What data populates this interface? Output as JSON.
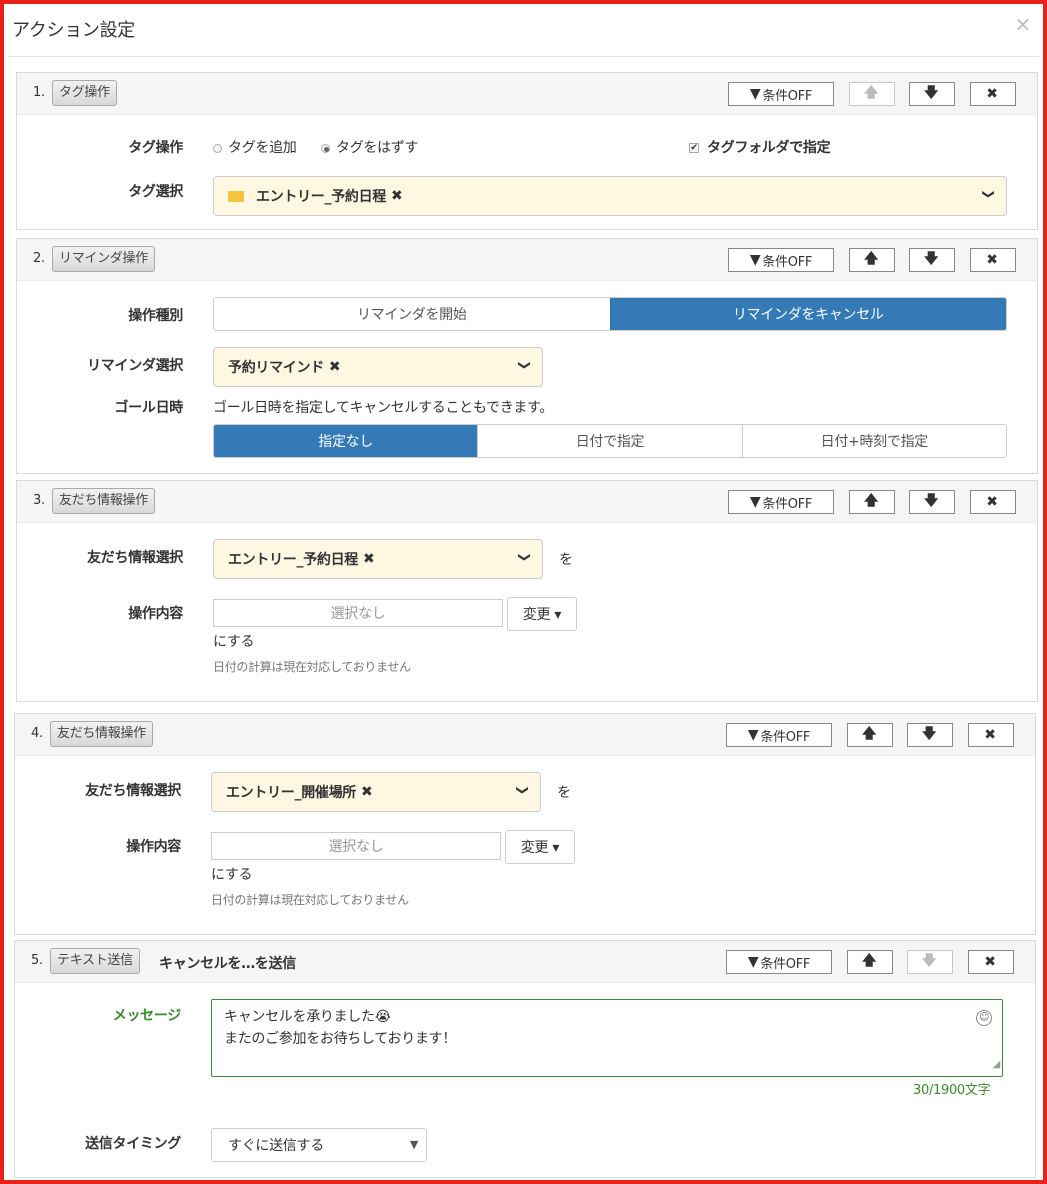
{
  "modal": {
    "title": "アクション設定",
    "close": "×"
  },
  "common": {
    "cond_off": "条件OFF",
    "up": "🡅",
    "down": "🡇",
    "delete": "✖",
    "filter": "▼",
    "chevron": "❯",
    "remove": "✖"
  },
  "panel1": {
    "num": "1.",
    "tag": "タグ操作",
    "op_label": "タグ操作",
    "radio_add": "タグを追加",
    "radio_remove": "タグをはずす",
    "radio_selected": "タグをはずす",
    "folder_check": "タグフォルダで指定",
    "folder_checked": true,
    "select_label": "タグ選択",
    "selected_tag": "エントリー_予約日程"
  },
  "panel2": {
    "num": "2.",
    "tag": "リマインダ操作",
    "type_label": "操作種別",
    "type_options": [
      "リマインダを開始",
      "リマインダをキャンセル"
    ],
    "type_selected": "リマインダをキャンセル",
    "select_label": "リマインダ選択",
    "selected": "予約リマインド",
    "goal_label": "ゴール日時",
    "goal_desc": "ゴール日時を指定してキャンセルすることもできます。",
    "goal_options": [
      "指定なし",
      "日付で指定",
      "日付+時刻で指定"
    ],
    "goal_selected": "指定なし"
  },
  "panel3": {
    "num": "3.",
    "tag": "友だち情報操作",
    "select_label": "友だち情報選択",
    "selected": "エントリー_予約日程",
    "wo": "を",
    "content_label": "操作内容",
    "content_value": "選択なし",
    "change": "変更 ▾",
    "suru": "にする",
    "note": "日付の計算は現在対応しておりません"
  },
  "panel4": {
    "num": "4.",
    "tag": "友だち情報操作",
    "select_label": "友だち情報選択",
    "selected": "エントリー_開催場所",
    "wo": "を",
    "content_label": "操作内容",
    "content_value": "選択なし",
    "change": "変更 ▾",
    "suru": "にする",
    "note": "日付の計算は現在対応しておりません"
  },
  "panel5": {
    "num": "5.",
    "tag": "テキスト送信",
    "extra": "キャンセルを…を送信",
    "msg_label": "メッセージ",
    "msg_line1": "キャンセルを承りました😭",
    "msg_line2": "またのご参加をお待ちしております！",
    "counter": "30/1900文字",
    "timing_label": "送信タイミング",
    "timing_value": "すぐに送信する"
  },
  "colors": {
    "accent": "#337ab7",
    "highlight": "#fef8e3",
    "frame": "#e8211a",
    "green": "#3a8a2a"
  }
}
